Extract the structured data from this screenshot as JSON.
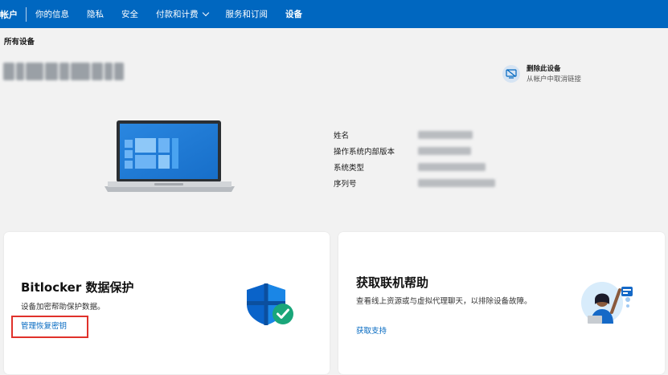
{
  "nav": {
    "brand": "帐户",
    "items": [
      "你的信息",
      "隐私",
      "安全",
      "付款和计费",
      "服务和订阅",
      "设备"
    ],
    "active_index": 5,
    "dropdown_index": 3
  },
  "page_title": "所有设备",
  "remove_device": {
    "title": "删除此设备",
    "subtitle": "从帐户中取消链接"
  },
  "specs": {
    "labels": [
      "姓名",
      "操作系统内部版本",
      "系统类型",
      "序列号"
    ]
  },
  "bitlocker_card": {
    "title": "Bitlocker 数据保护",
    "description": "设备加密帮助保护数据。",
    "link": "管理恢复密钥"
  },
  "help_card": {
    "title": "获取联机帮助",
    "description": "查看线上资源或与虚拟代理聊天，以排除设备故障。",
    "link": "获取支持"
  },
  "colors": {
    "brand_blue": "#0067c0",
    "link": "#0067c0",
    "highlight": "#e0312b",
    "shield_check": "#1aa67a"
  },
  "icons": [
    "unlink-device-icon",
    "laptop-illustration",
    "shield-check-icon",
    "support-agent-illustration",
    "chevron-down-icon"
  ]
}
